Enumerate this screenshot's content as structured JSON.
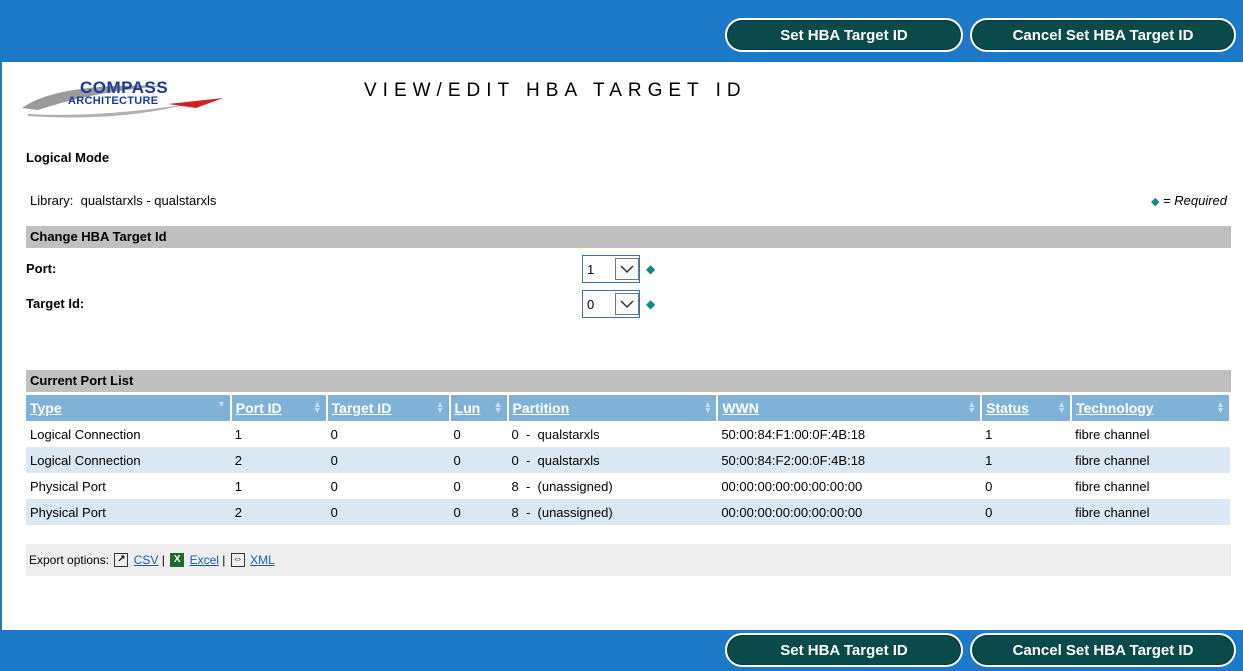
{
  "toolbar": {
    "set_label": "Set HBA Target ID",
    "cancel_label": "Cancel Set HBA Target ID"
  },
  "logo": {
    "line1": "COMPASS",
    "line2": "ARCHITECTURE"
  },
  "page_title": "VIEW/EDIT HBA TARGET ID",
  "mode": "Logical Mode",
  "library": {
    "label": "Library:",
    "value": "qualstarxls - qualstarxls"
  },
  "required_legend": "= Required",
  "change_section": {
    "title": "Change HBA Target Id",
    "port_label": "Port:",
    "port_value": "1",
    "target_label": "Target Id:",
    "target_value": "0"
  },
  "port_list": {
    "title": "Current Port List",
    "columns": [
      "Type",
      "Port ID",
      "Target ID",
      "Lun",
      "Partition",
      "WWN",
      "Status",
      "Technology"
    ],
    "rows": [
      [
        "Logical Connection",
        "1",
        "0",
        "0",
        "0  -  qualstarxls",
        "50:00:84:F1:00:0F:4B:18",
        "1",
        "fibre channel"
      ],
      [
        "Logical Connection",
        "2",
        "0",
        "0",
        "0  -  qualstarxls",
        "50:00:84:F2:00:0F:4B:18",
        "1",
        "fibre channel"
      ],
      [
        "Physical Port",
        "1",
        "0",
        "0",
        "8  -  (unassigned)",
        "00:00:00:00:00:00:00:00",
        "0",
        "fibre channel"
      ],
      [
        "Physical Port",
        "2",
        "0",
        "0",
        "8  -  (unassigned)",
        "00:00:00:00:00:00:00:00",
        "0",
        "fibre channel"
      ]
    ]
  },
  "export": {
    "label": "Export options:",
    "csv": "CSV",
    "excel": "Excel",
    "xml": "XML"
  },
  "icons": [
    "csv-icon",
    "excel-icon",
    "xml-icon",
    "required-arrow-icon",
    "chevron-down-icon",
    "sort-icon"
  ],
  "colors": {
    "bar": "#1b79c8",
    "button": "#0a4a4a",
    "header": "#7fb2d6",
    "section": "#c0c0c0",
    "stripe": "#d9e8f3",
    "required": "#13898a"
  }
}
